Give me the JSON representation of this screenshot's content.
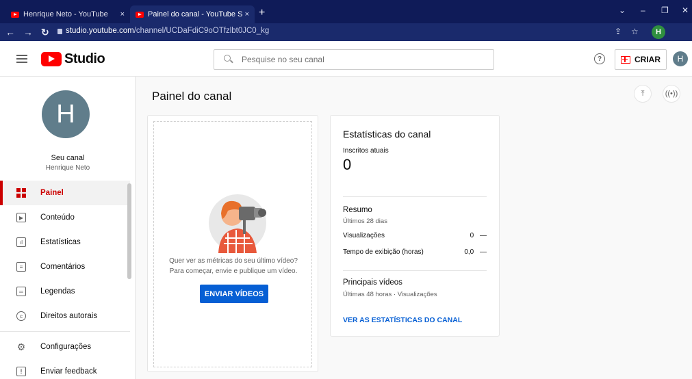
{
  "browser": {
    "tabs": [
      {
        "title": "Henrique Neto - YouTube",
        "close": "×"
      },
      {
        "title": "Painel do canal - YouTube Studio",
        "close": "×"
      }
    ],
    "new_tab": "+",
    "url_host": "studio.youtube.com",
    "url_path": "/channel/UCDaFdiC9oOTfzlbt0JC0_kg",
    "profile_initial": "H"
  },
  "header": {
    "logo_text": "Studio",
    "search_placeholder": "Pesquise no seu canal",
    "help": "?",
    "create_label": "CRIAR",
    "avatar_initial": "H"
  },
  "sidebar": {
    "avatar_initial": "H",
    "channel_label": "Seu canal",
    "channel_name": "Henrique Neto",
    "items": [
      {
        "label": "Painel",
        "icon": "dashboard-icon",
        "active": true
      },
      {
        "label": "Conteúdo",
        "icon": "content-icon"
      },
      {
        "label": "Estatísticas",
        "icon": "analytics-icon"
      },
      {
        "label": "Comentários",
        "icon": "comments-icon"
      },
      {
        "label": "Legendas",
        "icon": "subtitles-icon"
      },
      {
        "label": "Direitos autorais",
        "icon": "copyright-icon"
      },
      {
        "label": "Configurações",
        "icon": "gear-icon"
      },
      {
        "label": "Enviar feedback",
        "icon": "feedback-icon"
      }
    ]
  },
  "main": {
    "title": "Painel do canal",
    "upload_card": {
      "text_line1": "Quer ver as métricas do seu último vídeo?",
      "text_line2": "Para começar, envie e publique um vídeo.",
      "button": "ENVIAR VÍDEOS"
    },
    "stats_card": {
      "title": "Estatísticas do canal",
      "subscribers_label": "Inscritos atuais",
      "subscribers_value": "0",
      "summary_title": "Resumo",
      "summary_period": "Últimos 28 dias",
      "rows": [
        {
          "label": "Visualizações",
          "value": "0",
          "trend": "—"
        },
        {
          "label": "Tempo de exibição (horas)",
          "value": "0,0",
          "trend": "—"
        }
      ],
      "top_videos_title": "Principais vídeos",
      "top_videos_sub": "Últimas 48 horas · Visualizações",
      "link": "VER AS ESTATÍSTICAS DO CANAL"
    }
  },
  "colors": {
    "accent": "#cc0000",
    "primary_button": "#065fd4",
    "browser_bar": "#0f1b58",
    "avatar": "#607d8b"
  }
}
